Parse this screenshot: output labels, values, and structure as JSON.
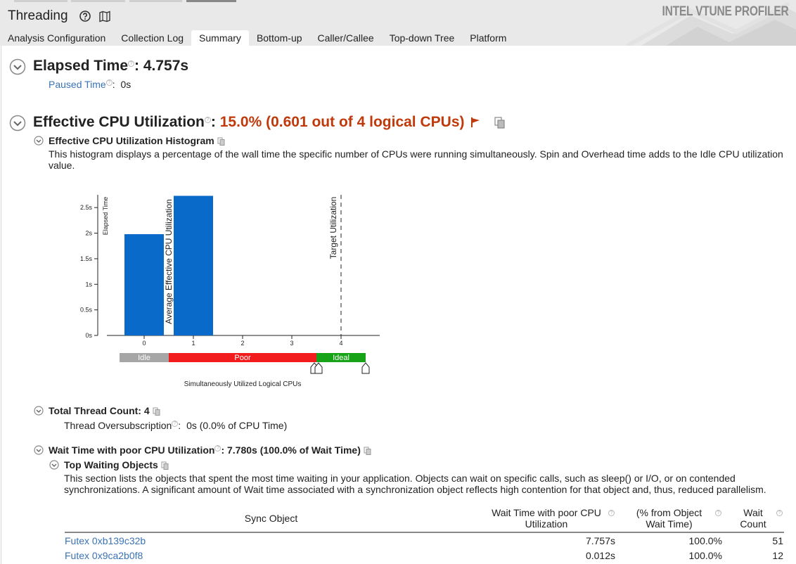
{
  "app": {
    "title": "Threading",
    "brand": "INTEL VTUNE PROFILER"
  },
  "tabs": [
    {
      "label": "Analysis Configuration",
      "active": false
    },
    {
      "label": "Collection Log",
      "active": false
    },
    {
      "label": "Summary",
      "active": true
    },
    {
      "label": "Bottom-up",
      "active": false
    },
    {
      "label": "Caller/Callee",
      "active": false
    },
    {
      "label": "Top-down Tree",
      "active": false
    },
    {
      "label": "Platform",
      "active": false
    }
  ],
  "elapsed": {
    "label": "Elapsed Time",
    "value": ": 4.757s",
    "paused_label": "Paused Time",
    "paused_value": "0s"
  },
  "cpu": {
    "label": "Effective CPU Utilization",
    "colon": ":",
    "value": "15.0% (0.601 out of 4 logical CPUs)",
    "histogram_title": "Effective CPU Utilization Histogram",
    "histogram_desc": "This histogram displays a percentage of the wall time the specific number of CPUs were running simultaneously. Spin and Overhead time adds to the Idle CPU utilization value."
  },
  "chart_data": {
    "type": "bar",
    "categories": [
      "0",
      "1",
      "2",
      "3",
      "4"
    ],
    "values": [
      1.98,
      2.73,
      0,
      0,
      0
    ],
    "ylabel": "Elapsed Time",
    "xlabel": "Simultaneously Utilized Logical CPUs",
    "ylim": [
      0,
      2.75
    ],
    "yticks": [
      "0s",
      "0.5s",
      "1s",
      "1.5s",
      "2s",
      "2.5s"
    ],
    "ytick_values": [
      0,
      0.5,
      1,
      1.5,
      2,
      2.5
    ],
    "average_marker": {
      "label": "Average Effective CPU Utilization",
      "value": 0.601
    },
    "target_marker": {
      "label": "Target Utilization",
      "value": 4
    },
    "bands": [
      {
        "label": "Idle",
        "color": "#a6a6a6",
        "from": -0.5,
        "to": 0.5
      },
      {
        "label": "Poor",
        "color": "#f21c1c",
        "from": 0.5,
        "to": 3.5
      },
      {
        "label": "Ideal",
        "color": "#17a317",
        "from": 3.5,
        "to": 4.5
      }
    ],
    "bar_color": "#0a6ac9"
  },
  "threads": {
    "label": "Total Thread Count:",
    "value": "4",
    "oversub_label": "Thread Oversubscription",
    "oversub_value": "0s (0.0% of CPU Time)"
  },
  "wait": {
    "label": "Wait Time with poor CPU Utilization",
    "value": ": 7.780s (100.0% of Wait Time)",
    "top_title": "Top Waiting Objects",
    "top_desc": "This section lists the objects that spent the most time waiting in your application. Objects can wait on specific calls, such as sleep() or I/O, or on contended synchronizations. A significant amount of Wait time associated with a synchronization object reflects high contention for that object and, thus, reduced parallelism.",
    "columns": [
      "Sync Object",
      "Wait Time with poor CPU Utilization",
      "(% from Object Wait Time)",
      "Wait Count"
    ],
    "rows": [
      {
        "object": "Futex 0xb139c32b",
        "wait_time": "7.757s",
        "pct": "100.0%",
        "count": "51"
      },
      {
        "object": "Futex 0x9ca2b0f8",
        "wait_time": "0.012s",
        "pct": "100.0%",
        "count": "12"
      }
    ]
  }
}
